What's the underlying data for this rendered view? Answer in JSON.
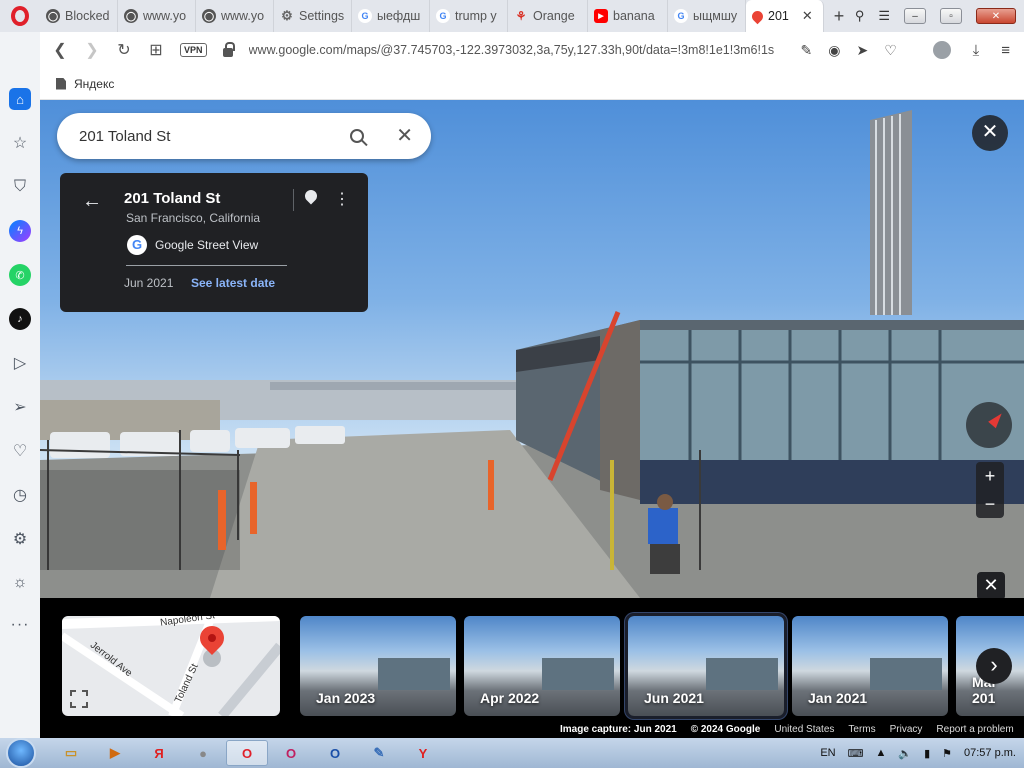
{
  "tabs": [
    {
      "title": "Blocked",
      "icon": "globe-icon",
      "fav_color": "#555555",
      "fav_char": "◯"
    },
    {
      "title": "www.yo",
      "icon": "globe-icon",
      "fav_color": "#555555",
      "fav_char": "◯"
    },
    {
      "title": "www.yo",
      "icon": "globe-icon",
      "fav_color": "#555555",
      "fav_char": "◯"
    },
    {
      "title": "Settings",
      "icon": "gear-icon",
      "fav_color": "#666666",
      "fav_char": "⚙"
    },
    {
      "title": "ыефдш",
      "icon": "google-icon",
      "fav_color": "#4285f4",
      "fav_char": "G"
    },
    {
      "title": "trump y",
      "icon": "google-icon",
      "fav_color": "#4285f4",
      "fav_char": "G"
    },
    {
      "title": "Orange",
      "icon": "orange-icon",
      "fav_color": "#d93025",
      "fav_char": "⚘"
    },
    {
      "title": "banana",
      "icon": "youtube-icon",
      "fav_color": "#ff0000",
      "fav_char": "▶"
    },
    {
      "title": "ыщмшу",
      "icon": "google-icon",
      "fav_color": "#4285f4",
      "fav_char": "G"
    },
    {
      "title": "201",
      "icon": "maps-pin-icon",
      "fav_color": "#ea4335",
      "fav_char": "●",
      "active": true
    }
  ],
  "address": {
    "vpn_label": "VPN",
    "url": "www.google.com/maps/@37.745703,-122.3973032,3a,75y,127.33h,90t/data=!3m8!1e1!3m6!1s"
  },
  "bookmarks": [
    {
      "label": "Яндекс"
    }
  ],
  "search": {
    "value": "201 Toland St"
  },
  "place": {
    "title": "201 Toland St",
    "subtitle": "San Francisco, California",
    "source": "Google Street View",
    "date": "Jun 2021",
    "latest_link": "See latest date"
  },
  "minimap": {
    "streets": [
      "Napoleon St",
      "Jerrold Ave",
      "Toland St"
    ]
  },
  "timeline": [
    {
      "label": "Jan 2023"
    },
    {
      "label": "Apr 2022"
    },
    {
      "label": "Jun 2021",
      "selected": true
    },
    {
      "label": "Jan 2021"
    },
    {
      "label": "Mar 201"
    }
  ],
  "credits": {
    "capture": "Image capture: Jun 2021",
    "copyright": "© 2024 Google",
    "country": "United States",
    "terms": "Terms",
    "privacy": "Privacy",
    "report": "Report a problem"
  },
  "taskbar": {
    "lang": "EN",
    "time": "07:57 p.m."
  },
  "colors": {
    "accent": "#1a73e8",
    "link": "#8ab4f8",
    "card_bg": "#202124",
    "pin": "#ea4335"
  }
}
